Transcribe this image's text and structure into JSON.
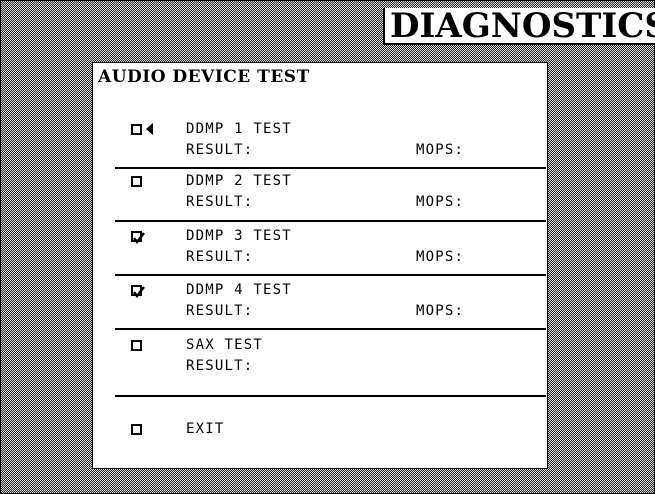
{
  "header": {
    "title": "DIAGNOSTICS"
  },
  "panel": {
    "title": "AUDIO DEVICE TEST",
    "tests": [
      {
        "label": "DDMP 1 TEST",
        "result_label": "RESULT:",
        "mops_label": "MOPS:",
        "checked": false,
        "selected": true
      },
      {
        "label": "DDMP 2 TEST",
        "result_label": "RESULT:",
        "mops_label": "MOPS:",
        "checked": false,
        "selected": false
      },
      {
        "label": "DDMP 3 TEST",
        "result_label": "RESULT:",
        "mops_label": "MOPS:",
        "checked": true,
        "selected": false
      },
      {
        "label": "DDMP 4 TEST",
        "result_label": "RESULT:",
        "mops_label": "MOPS:",
        "checked": true,
        "selected": false
      },
      {
        "label": "SAX TEST",
        "result_label": "RESULT:",
        "checked": false,
        "selected": false
      }
    ],
    "exit": {
      "label": "EXIT",
      "checked": false
    }
  },
  "colors": {
    "foreground": "#000000",
    "panel": "#ffffff",
    "dither_dark": "#2a2a2a",
    "dither_light": "#d8d8d8"
  },
  "icons": {
    "checkbox": "checkbox-icon",
    "check": "checkmark-icon",
    "cursor": "selection-cursor-icon"
  }
}
